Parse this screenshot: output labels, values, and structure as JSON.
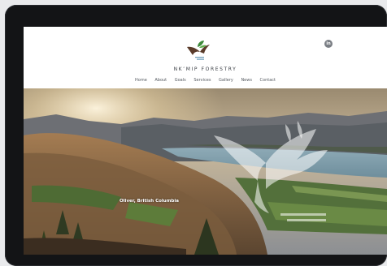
{
  "site": {
    "brand_name": "NK’MIP FORESTRY",
    "nav_items": [
      "Home",
      "About",
      "Goals",
      "Services",
      "Gallery",
      "News",
      "Contact"
    ],
    "social": {
      "icon": "linkedin-icon",
      "label": "in"
    }
  },
  "hero": {
    "caption": "Oliver, British Columbia",
    "watermark_icon": "eagle-logo-watermark"
  },
  "colors": {
    "device_frame": "#131416",
    "logo_green": "#3e8a3a",
    "logo_brown": "#5a3b2a",
    "text": "#3a3e44"
  }
}
